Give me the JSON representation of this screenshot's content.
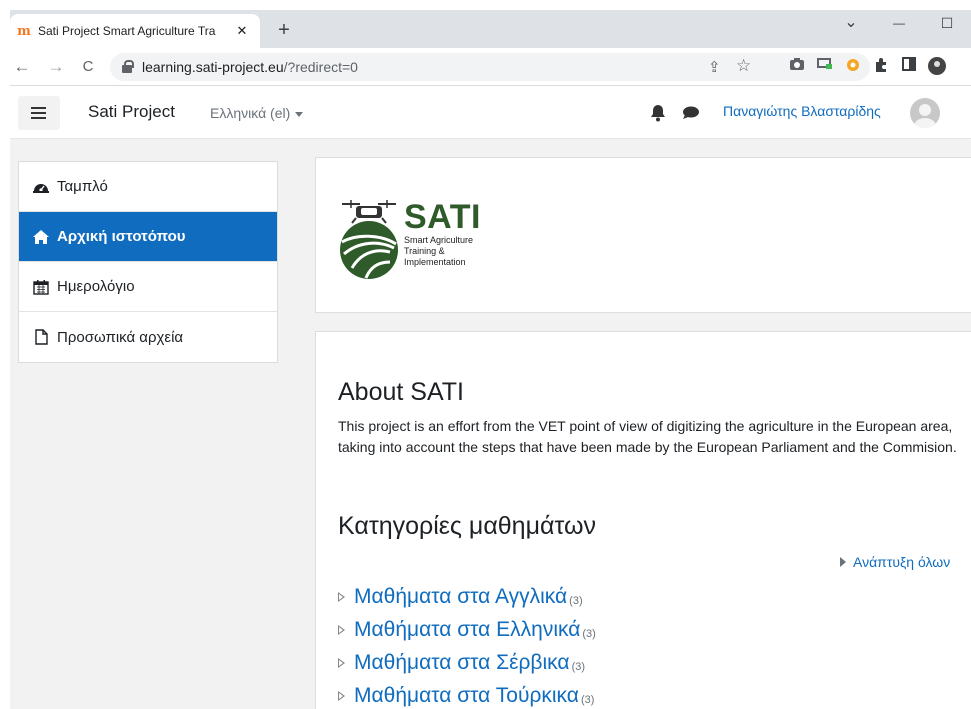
{
  "browser": {
    "tab_title": "Sati Project Smart Agriculture Tra",
    "tab_favicon": "m",
    "close_glyph": "✕",
    "new_tab_glyph": "+",
    "url_host": "learning.sati-project.eu",
    "url_path": "/?redirect=0",
    "back_glyph": "←",
    "forward_glyph": "→",
    "reload_glyph": "C",
    "star_glyph": "☆",
    "share_glyph": "⇪",
    "minimize_glyph": "—",
    "maximize_glyph": "☐",
    "dropdown_glyph": "⌄"
  },
  "navbar": {
    "brand": "Sati Project",
    "language": "Ελληνικά (el)",
    "user_name": "Παναγιώτης Βλασταρίδης"
  },
  "drawer": {
    "items": [
      {
        "label": "Ταμπλό",
        "icon": "dashboard-icon"
      },
      {
        "label": "Αρχική ιστοτόπου",
        "icon": "home-icon",
        "active": true
      },
      {
        "label": "Ημερολόγιο",
        "icon": "calendar-icon"
      },
      {
        "label": "Προσωπικά αρχεία",
        "icon": "file-icon"
      }
    ]
  },
  "logo": {
    "name": "SATI",
    "line1": "Smart Agriculture",
    "line2": "Training &",
    "line3": "Implementation"
  },
  "about": {
    "heading": "About SATI",
    "text": "This project is an effort from the VET  point of view of digitizing the agriculture in the European area, taking into account the steps that have been made by the European Parliament and the Commision."
  },
  "categories": {
    "heading": "Κατηγορίες μαθημάτων",
    "expand_all": "Ανάπτυξη όλων",
    "items": [
      {
        "name": "Μαθήματα στα Αγγλικά",
        "count": "(3)"
      },
      {
        "name": "Μαθήματα στα Ελληνικά",
        "count": "(3)"
      },
      {
        "name": "Μαθήματα στα Σέρβικα",
        "count": "(3)"
      },
      {
        "name": "Μαθήματα στα Τούρκικα",
        "count": "(3)"
      }
    ]
  },
  "colors": {
    "primary": "#0f6cbf",
    "logo_green": "#2f5a2a"
  }
}
